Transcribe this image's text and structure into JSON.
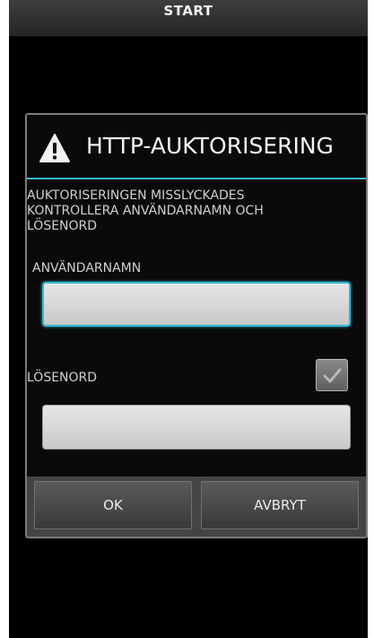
{
  "status_bar": {
    "title": "START"
  },
  "dialog": {
    "icon": "warning-triangle-icon",
    "title": "HTTP-AUKTORISERING",
    "message": "AUKTORISERINGEN MISSLYCKADES\n KONTROLLERA ANVÄNDARNAMN OCH\nLÖSENORD",
    "username": {
      "label": "ANVÄNDARNAMN",
      "value": ""
    },
    "password": {
      "label": "LÖSENORD",
      "value": "",
      "show_checkbox_checked": true,
      "checkbox_icon": "checkmark-icon"
    },
    "buttons": {
      "ok_label": "OK",
      "cancel_label": "AVBRYT"
    }
  },
  "colors": {
    "accent": "#35b6d6",
    "background": "#000000",
    "dialog_border": "#7a7a7a"
  }
}
